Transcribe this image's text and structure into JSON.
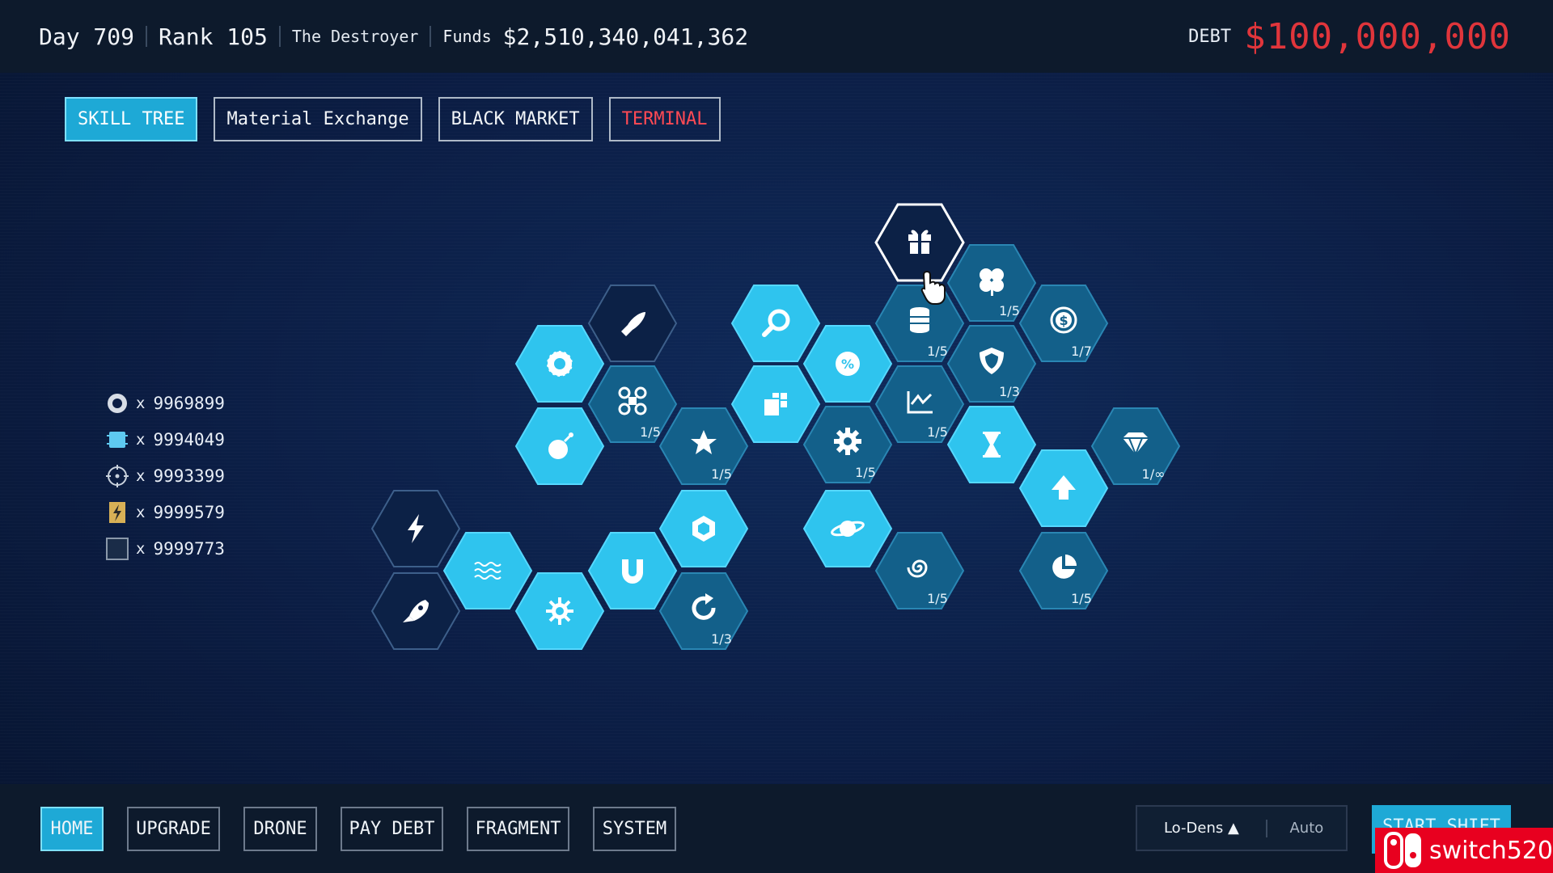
{
  "topbar": {
    "day": "Day 709",
    "rank": "Rank 105",
    "title": "The Destroyer",
    "funds_label": "Funds",
    "funds_value": "$2,510,340,041,362",
    "debt_label": "DEBT",
    "debt_value": "$100,000,000"
  },
  "tabs": [
    {
      "label": "SKILL TREE",
      "active": true
    },
    {
      "label": "Material Exchange"
    },
    {
      "label": "BLACK MARKET"
    },
    {
      "label": "TERMINAL",
      "danger": true
    }
  ],
  "resources": [
    {
      "icon": "gear-ring-icon",
      "x": "x",
      "count": "9969899"
    },
    {
      "icon": "chip-icon",
      "x": "x",
      "count": "9994049"
    },
    {
      "icon": "crosshair-icon",
      "x": "x",
      "count": "9993399"
    },
    {
      "icon": "energy-cell-icon",
      "x": "x",
      "count": "9999579"
    },
    {
      "icon": "empty-box-icon",
      "x": "x",
      "count": "9999773"
    }
  ],
  "skills": [
    {
      "id": "gift",
      "icon": "gift-icon",
      "style": "selected",
      "label": ""
    },
    {
      "id": "clover",
      "icon": "clover-icon",
      "style": "dim",
      "label": "1/5"
    },
    {
      "id": "coins",
      "icon": "coins-stack-icon",
      "style": "dim",
      "label": "1/5"
    },
    {
      "id": "dollar-coin",
      "icon": "dollar-coin-icon",
      "style": "dim",
      "label": "1/7"
    },
    {
      "id": "bullet",
      "icon": "bullet-icon",
      "style": "locked",
      "label": ""
    },
    {
      "id": "magnify",
      "icon": "magnifier-icon",
      "style": "bright",
      "label": ""
    },
    {
      "id": "percent",
      "icon": "percent-badge-icon",
      "style": "bright",
      "label": ""
    },
    {
      "id": "shield",
      "icon": "shield-icon",
      "style": "dim",
      "label": "1/3"
    },
    {
      "id": "sawblade",
      "icon": "sawblade-icon",
      "style": "bright",
      "label": ""
    },
    {
      "id": "drone",
      "icon": "drone-icon",
      "style": "dim",
      "label": "1/5"
    },
    {
      "id": "blocks",
      "icon": "blocks-icon",
      "style": "bright",
      "label": ""
    },
    {
      "id": "chart",
      "icon": "chart-icon",
      "style": "dim",
      "label": "1/5"
    },
    {
      "id": "bomb",
      "icon": "bomb-icon",
      "style": "bright",
      "label": ""
    },
    {
      "id": "star",
      "icon": "star-icon",
      "style": "dim",
      "label": "1/5"
    },
    {
      "id": "cog",
      "icon": "cog-icon",
      "style": "dim",
      "label": "1/5"
    },
    {
      "id": "hourglass",
      "icon": "hourglass-icon",
      "style": "bright",
      "label": ""
    },
    {
      "id": "diamond",
      "icon": "diamond-icon",
      "style": "dim",
      "label": "1/∞"
    },
    {
      "id": "arrow-up",
      "icon": "arrow-up-icon",
      "style": "bright",
      "label": ""
    },
    {
      "id": "lightning",
      "icon": "lightning-icon",
      "style": "locked",
      "label": ""
    },
    {
      "id": "waves",
      "icon": "waves-icon",
      "style": "bright",
      "label": ""
    },
    {
      "id": "magnet",
      "icon": "magnet-icon",
      "style": "bright",
      "label": ""
    },
    {
      "id": "gem",
      "icon": "hex-gem-icon",
      "style": "bright",
      "label": ""
    },
    {
      "id": "planet",
      "icon": "planet-icon",
      "style": "bright",
      "label": ""
    },
    {
      "id": "rocket",
      "icon": "rocket-icon",
      "style": "locked",
      "label": ""
    },
    {
      "id": "sun",
      "icon": "sun-gear-icon",
      "style": "bright",
      "label": ""
    },
    {
      "id": "refresh",
      "icon": "refresh-icon",
      "style": "dim",
      "label": "1/3"
    },
    {
      "id": "spiral",
      "icon": "spiral-icon",
      "style": "dim",
      "label": "1/5"
    },
    {
      "id": "pie",
      "icon": "pie-icon",
      "style": "dim",
      "label": "1/5"
    }
  ],
  "bottom": {
    "buttons": [
      {
        "label": "HOME",
        "active": true
      },
      {
        "label": "UPGRADE"
      },
      {
        "label": "DRONE"
      },
      {
        "label": "PAY DEBT"
      },
      {
        "label": "FRAGMENT"
      },
      {
        "label": "SYSTEM"
      }
    ],
    "density_label": "Lo-Dens ▲",
    "auto_label": "Auto",
    "start_label": "START SHIFT"
  },
  "watermark": "switch520",
  "colors": {
    "accent": "#1ea9d6",
    "bright_hex": "#2fc4ee",
    "dim_hex": "#13608a",
    "danger": "#e0353b",
    "watermark_red": "#e8001f"
  }
}
